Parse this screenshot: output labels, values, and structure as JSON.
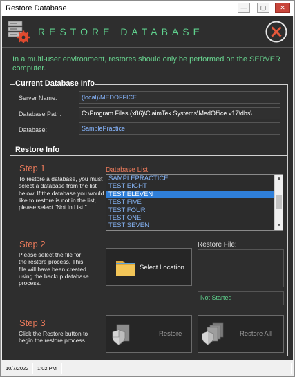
{
  "window": {
    "title": "Restore Database",
    "min_glyph": "—",
    "max_glyph": "▢",
    "close_glyph": "✕"
  },
  "header": {
    "title": "RESTORE DATABASE",
    "icon": "server-gear-icon",
    "close_icon": "circle-x-icon"
  },
  "notice": "In a multi-user environment, restores should only be performed on the SERVER computer.",
  "current_db": {
    "legend": "Current Database Info",
    "server_label": "Server Name:",
    "server_value": "(local)\\MEDOFFICE",
    "path_label": "Database Path:",
    "path_value": "C:\\Program Files (x86)\\ClaimTek Systems\\MedOffice v17\\dbs\\",
    "db_label": "Database:",
    "db_value": "SamplePractice"
  },
  "restore_info": {
    "legend": "Restore Info",
    "step1": {
      "title": "Step 1",
      "text": "To restore a database, you must select a database from the list below. If the database you would like to restore is not in the list, please select \"Not In List.\""
    },
    "db_list_label": "Database List",
    "db_list": [
      "SAMPLEPRACTICE",
      "TEST EIGHT",
      "TEST ELEVEN",
      "TEST FIVE",
      "TEST FOUR",
      "TEST ONE",
      "TEST SEVEN"
    ],
    "db_selected": "TEST ELEVEN",
    "step2": {
      "title": "Step 2",
      "text": "Please select the file for the restore process. This file will have been created using the backup database process."
    },
    "select_location_label": "Select Location",
    "restore_file_label": "Restore File:",
    "status": "Not Started",
    "step3": {
      "title": "Step 3",
      "text": "Click the Restore button to begin the restore process."
    },
    "restore_label": "Restore",
    "restore_all_label": "Restore All"
  },
  "statusbar": {
    "date": "10/7/2022",
    "time": "1:02 PM"
  },
  "colors": {
    "accent_green": "#5fd18d",
    "step_orange": "#e8795a",
    "selection_blue": "#2f7fd9",
    "panel_bg": "#2e2e2e"
  }
}
